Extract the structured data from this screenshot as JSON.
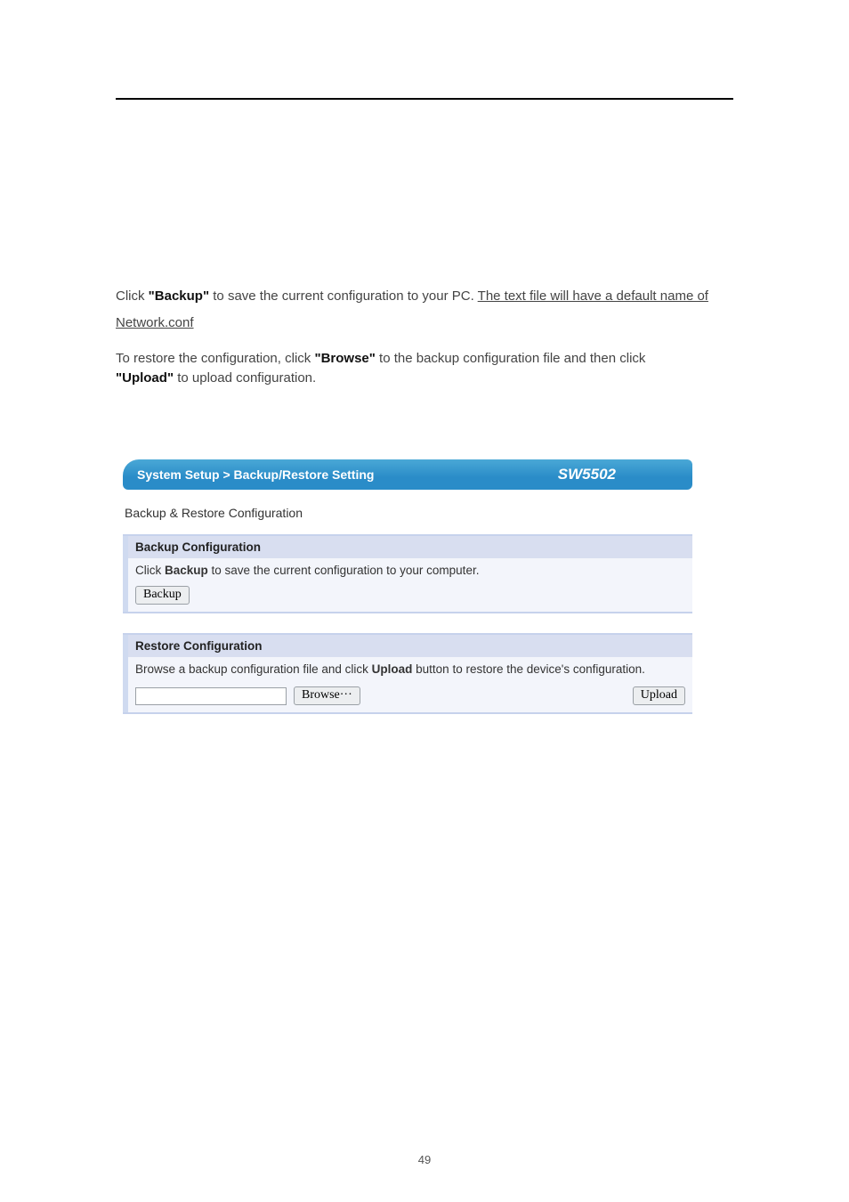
{
  "doc": {
    "para1_pre": "Click ",
    "backup_label": "\"Backup\"",
    "para1_post": " to save the current configuration to your PC. ",
    "para2_underline_a": "The text file will have a default name of ",
    "para2_underline_b": "Network.conf",
    "para3_pre": "To restore the configuration, click ",
    "browse_label": "\"Browse\"",
    "para3_mid": " to the backup configuration file and then click ",
    "upload_label": "\"Upload\"",
    "para3_post": " to upload configuration."
  },
  "fig": {
    "breadcrumb": "System Setup > Backup/Restore Setting",
    "model": "SW5502",
    "section_title": "Backup & Restore Configuration",
    "backup_panel": {
      "heading": "Backup Configuration",
      "text_pre": "Click ",
      "text_bold": "Backup",
      "text_post": " to save the current configuration to your computer.",
      "button": "Backup"
    },
    "restore_panel": {
      "heading": "Restore Configuration",
      "text_pre": "Browse a backup configuration file and click ",
      "text_bold": "Upload",
      "text_post": " button to restore the device's configuration.",
      "browse_button": "Browse···",
      "upload_button": "Upload"
    }
  },
  "page_number": "49"
}
